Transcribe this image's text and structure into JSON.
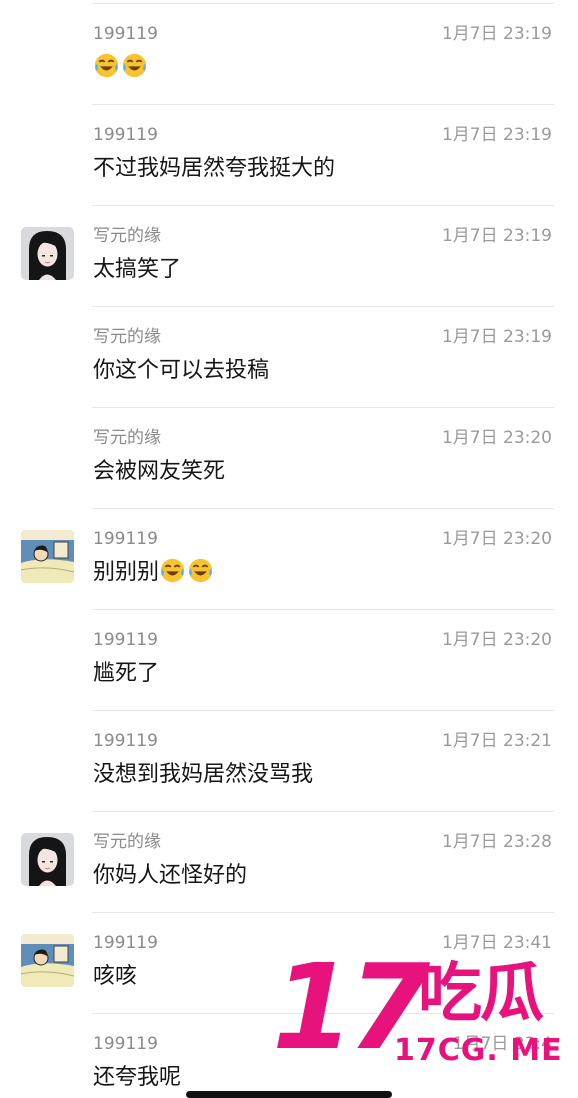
{
  "messages": [
    {
      "sender": "199119",
      "time": "1月7日 23:19",
      "text": "",
      "emoji_count": 2,
      "avatar": "none"
    },
    {
      "sender": "199119",
      "time": "1月7日 23:19",
      "text": "不过我妈居然夸我挺大的",
      "emoji_count": 0,
      "avatar": "none"
    },
    {
      "sender": "写元的缘",
      "time": "1月7日 23:19",
      "text": "太搞笑了",
      "emoji_count": 0,
      "avatar": "girl-avatar"
    },
    {
      "sender": "写元的缘",
      "time": "1月7日 23:19",
      "text": "你这个可以去投稿",
      "emoji_count": 0,
      "avatar": "none"
    },
    {
      "sender": "写元的缘",
      "time": "1月7日 23:20",
      "text": "会被网友笑死",
      "emoji_count": 0,
      "avatar": "none"
    },
    {
      "sender": "199119",
      "time": "1月7日 23:20",
      "text": "别别别",
      "emoji_count": 2,
      "avatar": "cartoon-avatar"
    },
    {
      "sender": "199119",
      "time": "1月7日 23:20",
      "text": "尴死了",
      "emoji_count": 0,
      "avatar": "none"
    },
    {
      "sender": "199119",
      "time": "1月7日 23:21",
      "text": "没想到我妈居然没骂我",
      "emoji_count": 0,
      "avatar": "none"
    },
    {
      "sender": "写元的缘",
      "time": "1月7日 23:28",
      "text": "你妈人还怪好的",
      "emoji_count": 0,
      "avatar": "girl-avatar"
    },
    {
      "sender": "199119",
      "time": "1月7日 23:41",
      "text": "咳咳",
      "emoji_count": 0,
      "avatar": "cartoon-avatar"
    },
    {
      "sender": "199119",
      "time": "1月7日 23:4",
      "text": "还夸我呢",
      "emoji_count": 0,
      "avatar": "none"
    }
  ],
  "emoji_icon": "tears-of-joy-emoji",
  "watermark": {
    "number": "17",
    "brand": "吃瓜",
    "domain": "17CG. ME",
    "color": "#e8127c"
  }
}
